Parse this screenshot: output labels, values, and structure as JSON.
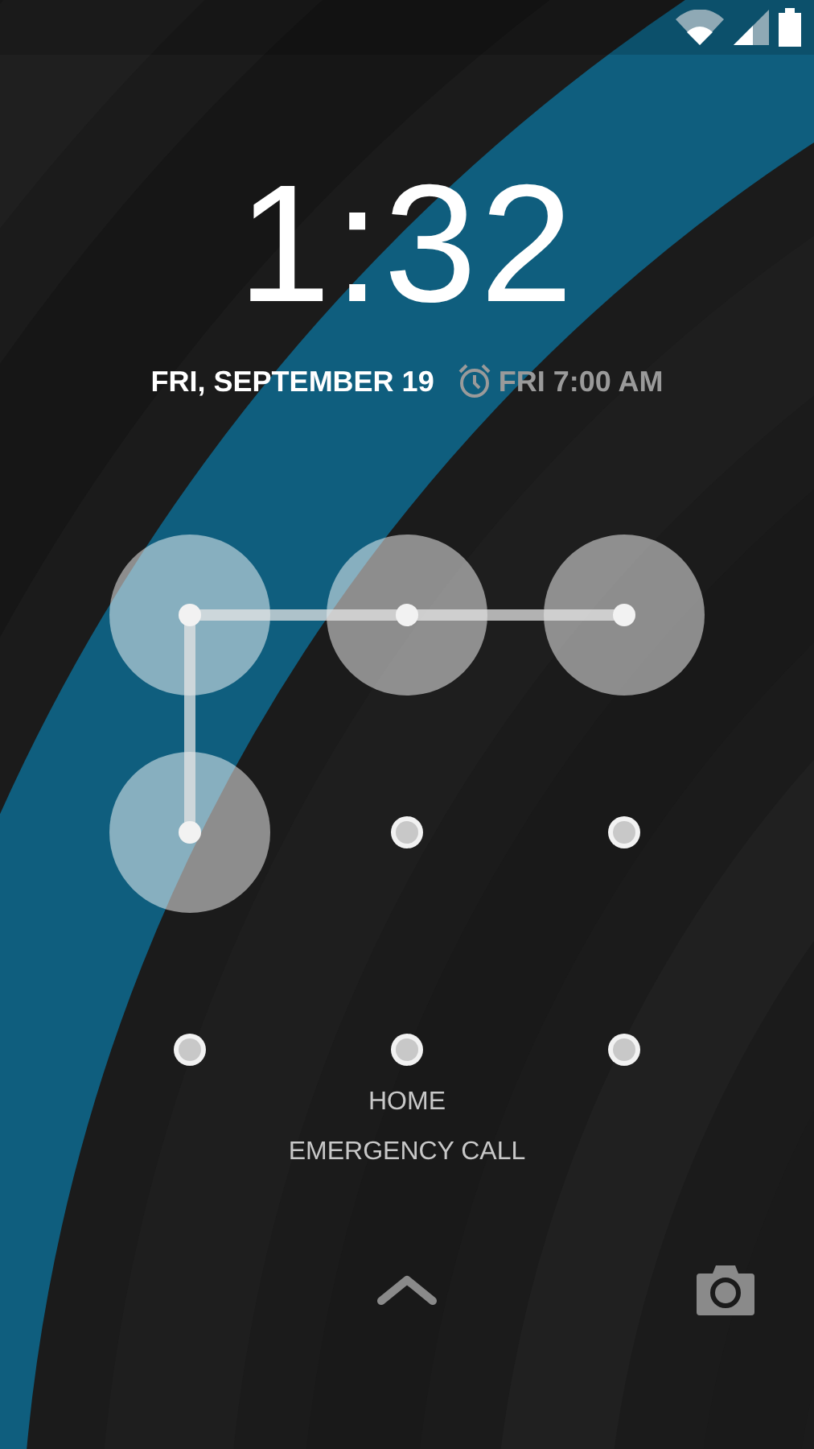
{
  "clock": {
    "time": "1:32"
  },
  "date": {
    "text": "FRI, SEPTEMBER 19",
    "alarm": "FRI 7:00 AM"
  },
  "pattern": {
    "dots": [
      {
        "selected": true
      },
      {
        "selected": true
      },
      {
        "selected": true
      },
      {
        "selected": true
      },
      {
        "selected": false
      },
      {
        "selected": false
      },
      {
        "selected": false
      },
      {
        "selected": false
      },
      {
        "selected": false
      }
    ]
  },
  "carrier": "HOME",
  "emergency": "EMERGENCY CALL"
}
